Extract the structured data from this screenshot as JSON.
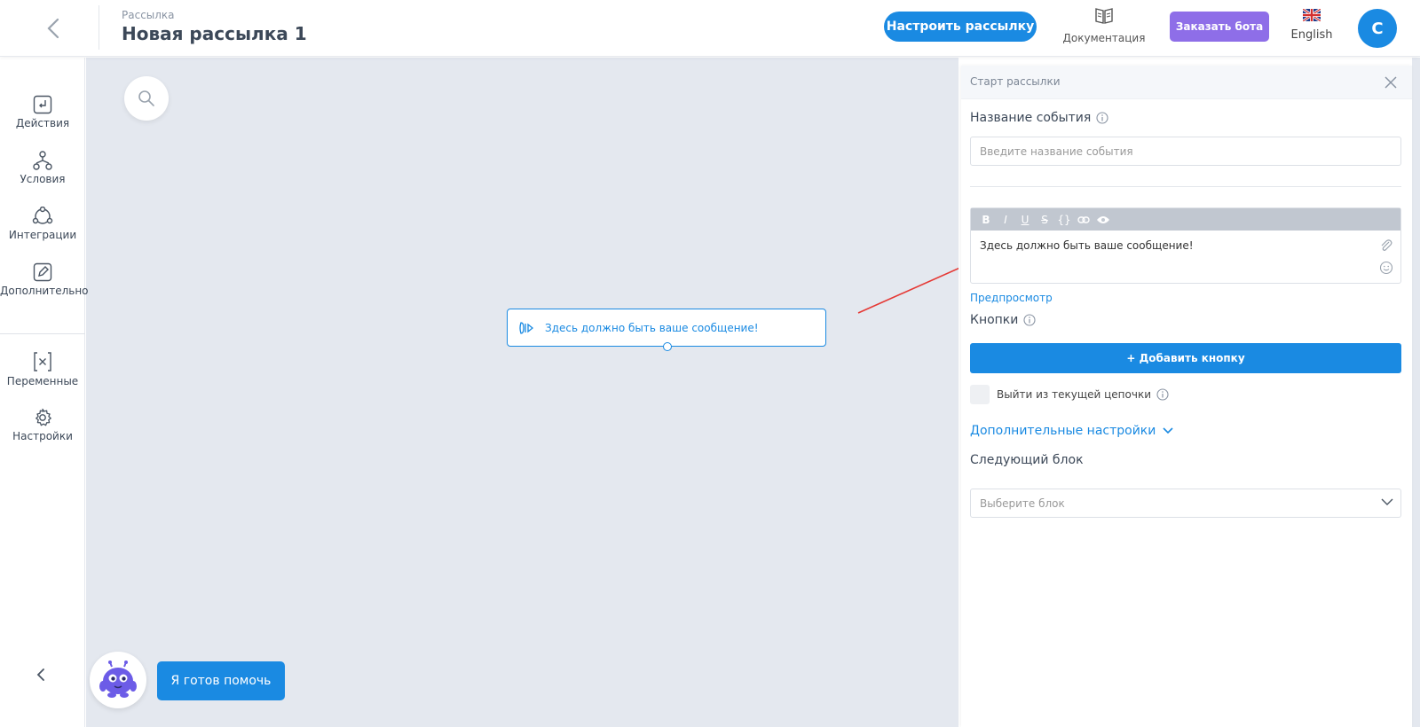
{
  "header": {
    "breadcrumb": "Рассылка",
    "title": "Новая рассылка 1",
    "setup_button": "Настроить рассылку",
    "docs_label": "Документация",
    "order_bot_button": "Заказать бота",
    "language_label": "English",
    "avatar_letter": "C"
  },
  "sidebar": {
    "items": [
      {
        "label": "Действия",
        "icon": "actions-icon"
      },
      {
        "label": "Условия",
        "icon": "conditions-icon"
      },
      {
        "label": "Интеграции",
        "icon": "integrations-icon"
      },
      {
        "label": "Дополнительно",
        "icon": "edit-icon"
      },
      {
        "label": "Переменные",
        "icon": "variables-icon"
      },
      {
        "label": "Настройки",
        "icon": "gear-icon"
      }
    ]
  },
  "canvas": {
    "node_text": "Здесь должно быть ваше сообщение!",
    "help_button": "Я готов помочь"
  },
  "panel": {
    "title": "Старт рассылки",
    "event_name_label": "Название события",
    "event_name_placeholder": "Введите название события",
    "toolbar": [
      "B",
      "I",
      "U",
      "S",
      "{}",
      "link",
      "eye"
    ],
    "message_text": "Здесь должно быть ваше сообщение!",
    "preview_link": "Предпросмотр",
    "buttons_label": "Кнопки",
    "add_button": "+ Добавить кнопку",
    "exit_chain_label": "Выйти из текущей цепочки",
    "exit_chain_checked": false,
    "advanced_settings": "Дополнительные настройки",
    "next_block_label": "Следующий блок",
    "next_block_placeholder": "Выберите блок"
  },
  "colors": {
    "accent": "#1a8ae2",
    "purple": "#8e6ee8",
    "canvas_bg": "#e4e8ef",
    "arrow": "#e53935"
  }
}
